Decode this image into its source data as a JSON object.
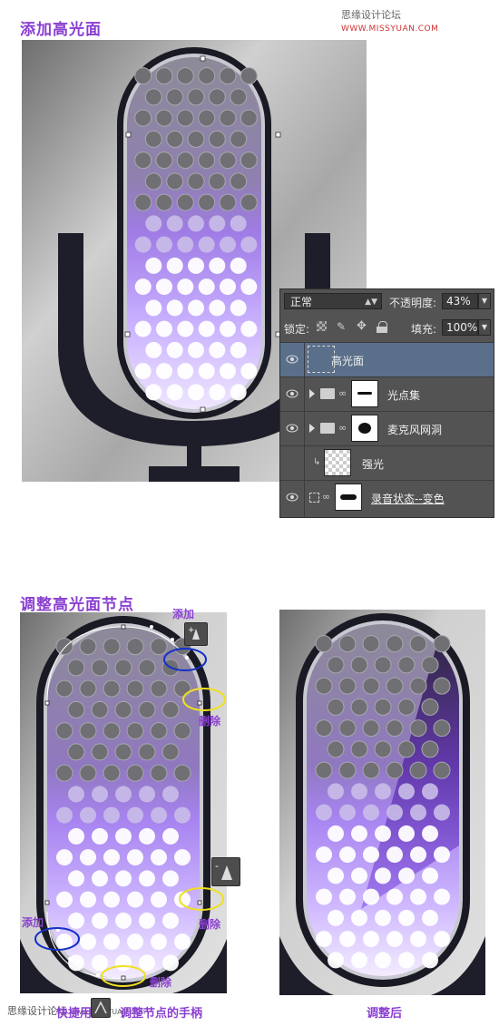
{
  "header": {
    "watermark_cn": "思缘设计论坛",
    "watermark_site": "WWW.MISSYUAN.COM"
  },
  "section1": {
    "title": "添加高光面"
  },
  "layers_panel": {
    "blend_mode": "正常",
    "opacity_label": "不透明度:",
    "opacity_value": "43%",
    "lock_label": "锁定:",
    "fill_label": "填充:",
    "fill_value": "100%",
    "layers": [
      {
        "name": "高光面",
        "selected": true
      },
      {
        "name": "光点集",
        "type": "group"
      },
      {
        "name": "麦克风网洞",
        "type": "group"
      },
      {
        "name": "强光"
      },
      {
        "name": "录音状态--变色"
      }
    ]
  },
  "section2": {
    "title": "调整高光面节点",
    "annotations": {
      "add_top": "添加",
      "delete_upper": "删除",
      "delete_lower_right": "删除",
      "add_bottom_left": "添加",
      "delete_bottom": "删除",
      "after_label": "调整后"
    },
    "footer": {
      "left_cn": "思缘设计论坛",
      "left_site": "www.MISSYUAN.com",
      "shortcut_text": "快捷用",
      "handle_text": "调整节点的手柄"
    }
  },
  "colors": {
    "accent_purple": "#8a3fd1",
    "ring_blue": "#1430c8",
    "ring_yellow": "#f0e020",
    "mic_body": "#1c1c28",
    "metal_bg": "#b5b5b5"
  }
}
